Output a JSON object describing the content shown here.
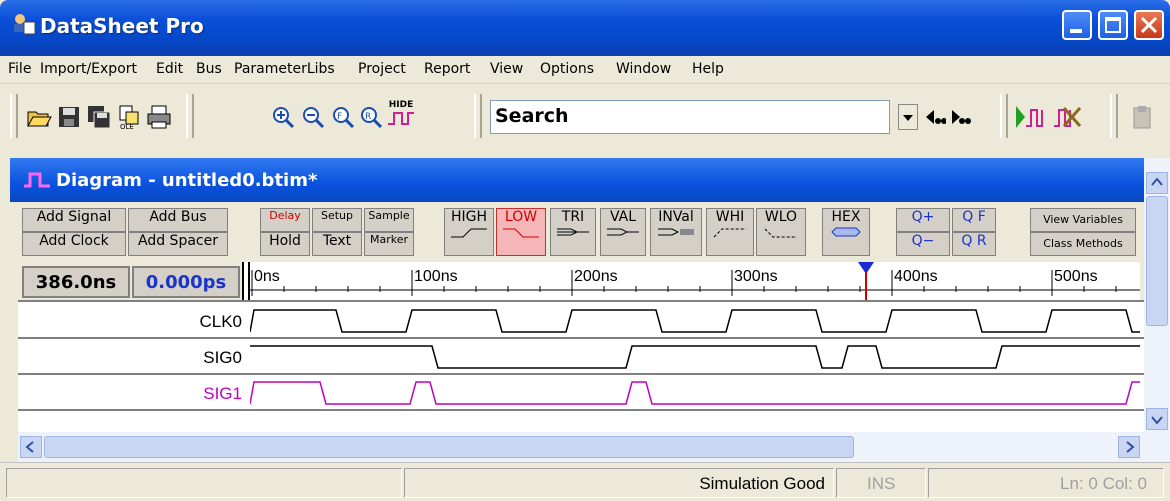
{
  "window": {
    "title": "DataSheet Pro"
  },
  "menu": [
    "File",
    "Import/Export",
    "Edit",
    "Bus",
    "ParameterLibs",
    "Project",
    "Report",
    "View",
    "Options",
    "Window",
    "Help"
  ],
  "toolbar": {
    "search_value": "Search",
    "zoom_hide_label": "HIDE",
    "icons": [
      "open-icon",
      "save-icon",
      "save-all-icon",
      "ole-icon",
      "print-icon",
      "zoom-in-icon",
      "zoom-out-icon",
      "zoom-fit-icon",
      "zoom-range-icon",
      "hide-waveform-icon",
      "search-prev-icon",
      "search-next-icon",
      "simulate-icon",
      "stop-simulate-icon",
      "paste-icon"
    ]
  },
  "diagram": {
    "title": "Diagram - untitled0.btim*",
    "buttons": {
      "add_signal": "Add Signal",
      "add_bus": "Add Bus",
      "add_clock": "Add Clock",
      "add_spacer": "Add Spacer",
      "delay": "Delay",
      "setup": "Setup",
      "sample": "Sample",
      "hold": "Hold",
      "text": "Text",
      "marker": "Marker",
      "high": "HIGH",
      "low": "LOW",
      "tri": "TRI",
      "val": "VAL",
      "inval": "INVal",
      "whi": "WHI",
      "wlo": "WLO",
      "hex": "HEX",
      "zoom_in": "Q+",
      "zoom_out": "Q−",
      "zoom_full": "Q F",
      "zoom_reset": "Q R",
      "view_variables": "View Variables",
      "class_methods": "Class Methods"
    },
    "cursor_time": "386.0ns",
    "delta_time": "0.000ps",
    "timeline_labels": [
      "0ns",
      "100ns",
      "200ns",
      "300ns",
      "400ns",
      "500ns"
    ],
    "signals": [
      {
        "name": "CLK0",
        "color": "#000000"
      },
      {
        "name": "SIG0",
        "color": "#000000"
      },
      {
        "name": "SIG1",
        "color": "#c000c0"
      }
    ]
  },
  "status": {
    "message": "Simulation Good",
    "mode": "INS",
    "position": "Ln: 0  Col: 0"
  },
  "colors": {
    "accent": "#0a52dd",
    "marker": "#cc0000",
    "sig1": "#c000c0"
  }
}
